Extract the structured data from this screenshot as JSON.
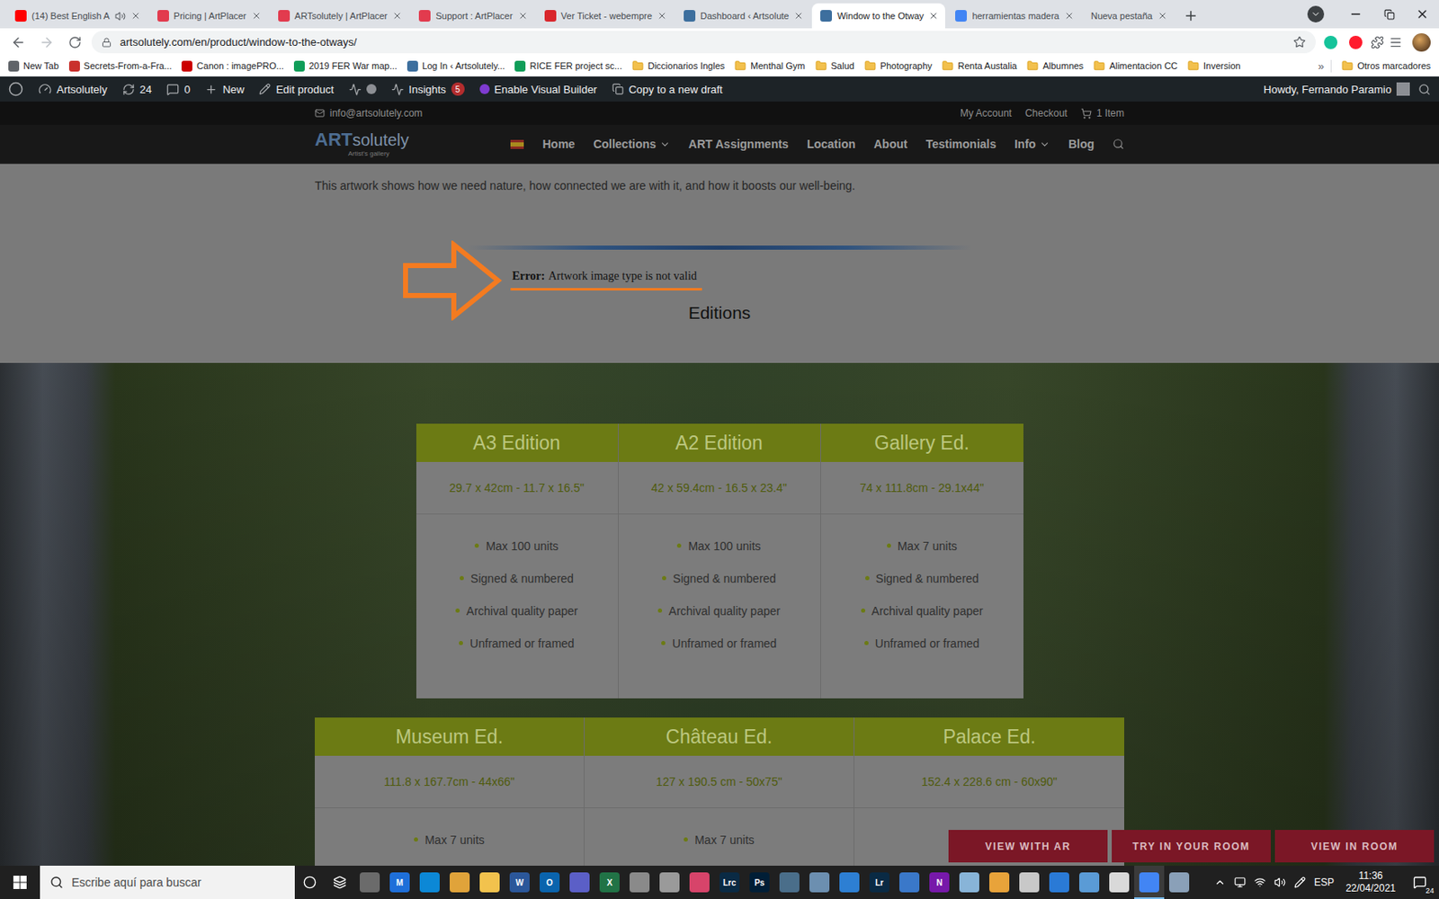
{
  "browser": {
    "tabs": [
      {
        "title": "(14) Best English A",
        "selected": false,
        "audio": true,
        "favicon": true,
        "color": "#ff0000"
      },
      {
        "title": "Pricing | ArtPlacer",
        "selected": false,
        "audio": false,
        "favicon": true,
        "color": "#e23b4e"
      },
      {
        "title": "ARTsolutely | ArtPlacer",
        "selected": false,
        "audio": false,
        "favicon": true,
        "color": "#e23b4e"
      },
      {
        "title": "Support : ArtPlacer",
        "selected": false,
        "audio": false,
        "favicon": true,
        "color": "#e23b4e"
      },
      {
        "title": "Ver Ticket - webempre",
        "selected": false,
        "audio": false,
        "favicon": true,
        "color": "#d9262c"
      },
      {
        "title": "Dashboard ‹ Artsolute",
        "selected": false,
        "audio": false,
        "favicon": true,
        "color": "#3d6f9e"
      },
      {
        "title": "Window to the Otway",
        "selected": true,
        "audio": false,
        "favicon": true,
        "color": "#3d6f9e"
      },
      {
        "title": "herramientas madera",
        "selected": false,
        "audio": false,
        "favicon": true,
        "color": "#4285f4"
      },
      {
        "title": "Nueva pestaña",
        "selected": false,
        "audio": false,
        "favicon": false
      }
    ],
    "url": "artsolutely.com/en/product/window-to-the-otways/",
    "bookmarks": [
      {
        "label": "New Tab",
        "kind": "link",
        "color": "#5f6368"
      },
      {
        "label": "Secrets-From-a-Fra...",
        "kind": "link",
        "color": "#c9302c"
      },
      {
        "label": "Canon : imagePRO...",
        "kind": "link",
        "color": "#cc0000"
      },
      {
        "label": "2019 FER War map...",
        "kind": "link",
        "color": "#0f9d58"
      },
      {
        "label": "Log In ‹ Artsolutely...",
        "kind": "link",
        "color": "#3d6f9e"
      },
      {
        "label": "RICE FER project sc...",
        "kind": "link",
        "color": "#0f9d58"
      },
      {
        "label": "Diccionarios Ingles",
        "kind": "folder"
      },
      {
        "label": "Menthal Gym",
        "kind": "folder"
      },
      {
        "label": "Salud",
        "kind": "folder"
      },
      {
        "label": "Photography",
        "kind": "folder"
      },
      {
        "label": "Renta Austalia",
        "kind": "folder"
      },
      {
        "label": "Albumnes",
        "kind": "folder"
      },
      {
        "label": "Alimentacion CC",
        "kind": "folder"
      },
      {
        "label": "Inversion",
        "kind": "folder"
      }
    ],
    "more": "»",
    "other_bookmarks": "Otros marcadores"
  },
  "admin_bar": {
    "site": "Artsolutely",
    "updates": "24",
    "comments": "0",
    "new": "New",
    "edit": "Edit product",
    "insights": "Insights",
    "insights_badge": "5",
    "builder": "Enable Visual Builder",
    "draft": "Copy to a new draft",
    "howdy": "Howdy, Fernando Paramio"
  },
  "site_top_bar": {
    "email": "info@artsolutely.com",
    "links": [
      "My Account",
      "Checkout"
    ],
    "cart": "1 Item"
  },
  "site_header": {
    "logo": {
      "strong": "ART",
      "rest": "solutely",
      "tagline": "Artist's gallery"
    },
    "nav": [
      {
        "label": "Home",
        "dropdown": false
      },
      {
        "label": "Collections",
        "dropdown": true
      },
      {
        "label": "ART Assignments",
        "dropdown": false
      },
      {
        "label": "Location",
        "dropdown": false
      },
      {
        "label": "About",
        "dropdown": false
      },
      {
        "label": "Testimonials",
        "dropdown": false
      },
      {
        "label": "Info",
        "dropdown": true
      },
      {
        "label": "Blog",
        "dropdown": false
      }
    ]
  },
  "content": {
    "description": "This artwork shows how we need nature, how connected we are with it, and how it boosts our well-being.",
    "error": {
      "label": "Error:",
      "message": "Artwork image type is not valid"
    },
    "section_title": "Editions"
  },
  "editions": [
    [
      {
        "title": "A3 Edition",
        "size": "29.7 x 42cm - 11.7 x 16.5\"",
        "features": [
          "Max 100 units",
          "Signed & numbered",
          "Archival quality paper",
          "Unframed or framed"
        ]
      },
      {
        "title": "A2 Edition",
        "size": "42 x 59.4cm - 16.5 x 23.4\"",
        "features": [
          "Max 100 units",
          "Signed & numbered",
          "Archival quality paper",
          "Unframed or framed"
        ]
      },
      {
        "title": "Gallery Ed.",
        "size": "74 x 111.8cm - 29.1x44\"",
        "features": [
          "Max 7 units",
          "Signed & numbered",
          "Archival quality paper",
          "Unframed or framed"
        ]
      }
    ],
    [
      {
        "title": "Museum Ed.",
        "size": "111.8 x 167.7cm - 44x66\"",
        "features": [
          "Max 7 units"
        ]
      },
      {
        "title": "Château Ed.",
        "size": "127 x 190.5 cm - 50x75\"",
        "features": [
          "Max 7 units"
        ]
      },
      {
        "title": "Palace Ed.",
        "size": "152.4 x 228.6 cm - 60x90\"",
        "features": []
      }
    ]
  ],
  "room_buttons": [
    "VIEW WITH AR",
    "TRY IN YOUR ROOM",
    "VIEW IN ROOM"
  ],
  "taskbar": {
    "search_placeholder": "Escribe aquí para buscar",
    "apps": [
      {
        "glyph": "",
        "color": "#6b6b6b",
        "active": false
      },
      {
        "glyph": "M",
        "color": "#1e6fd9",
        "active": false
      },
      {
        "glyph": "",
        "color": "#0c88d6",
        "active": false
      },
      {
        "glyph": "",
        "color": "#e0a33a",
        "active": false
      },
      {
        "glyph": "",
        "color": "#f2c24d",
        "active": false
      },
      {
        "glyph": "W",
        "color": "#2b579a",
        "active": false
      },
      {
        "glyph": "O",
        "color": "#0a64ad",
        "active": false
      },
      {
        "glyph": "",
        "color": "#5b5fc7",
        "active": false
      },
      {
        "glyph": "X",
        "color": "#217346",
        "active": false
      },
      {
        "glyph": "",
        "color": "#8a8a8a",
        "active": false
      },
      {
        "glyph": "",
        "color": "#9a9a9a",
        "active": false
      },
      {
        "glyph": "",
        "color": "#d7446a",
        "active": false
      },
      {
        "glyph": "Lrc",
        "color": "#0a2a44",
        "active": false
      },
      {
        "glyph": "Ps",
        "color": "#001e36",
        "active": false
      },
      {
        "glyph": "",
        "color": "#4a6e8a",
        "active": false
      },
      {
        "glyph": "",
        "color": "#6c8fb0",
        "active": false
      },
      {
        "glyph": "",
        "color": "#2d7fd3",
        "active": false
      },
      {
        "glyph": "Lr",
        "color": "#0a2a44",
        "active": false
      },
      {
        "glyph": "",
        "color": "#3a78c9",
        "active": false
      },
      {
        "glyph": "N",
        "color": "#7719aa",
        "active": false
      },
      {
        "glyph": "",
        "color": "#88b4d8",
        "active": false
      },
      {
        "glyph": "",
        "color": "#e8a33a",
        "active": false
      },
      {
        "glyph": "",
        "color": "#c8c8c8",
        "active": false
      },
      {
        "glyph": "",
        "color": "#2a7ad6",
        "active": false
      },
      {
        "glyph": "",
        "color": "#5a9bd6",
        "active": false
      },
      {
        "glyph": "",
        "color": "#d9d9d9",
        "active": false
      },
      {
        "glyph": "",
        "color": "#4285f4",
        "active": true
      },
      {
        "glyph": "",
        "color": "#8aa0b8",
        "active": false
      }
    ],
    "language": "ESP",
    "time": "11:36",
    "date": "22/04/2021",
    "notifications": "24"
  }
}
